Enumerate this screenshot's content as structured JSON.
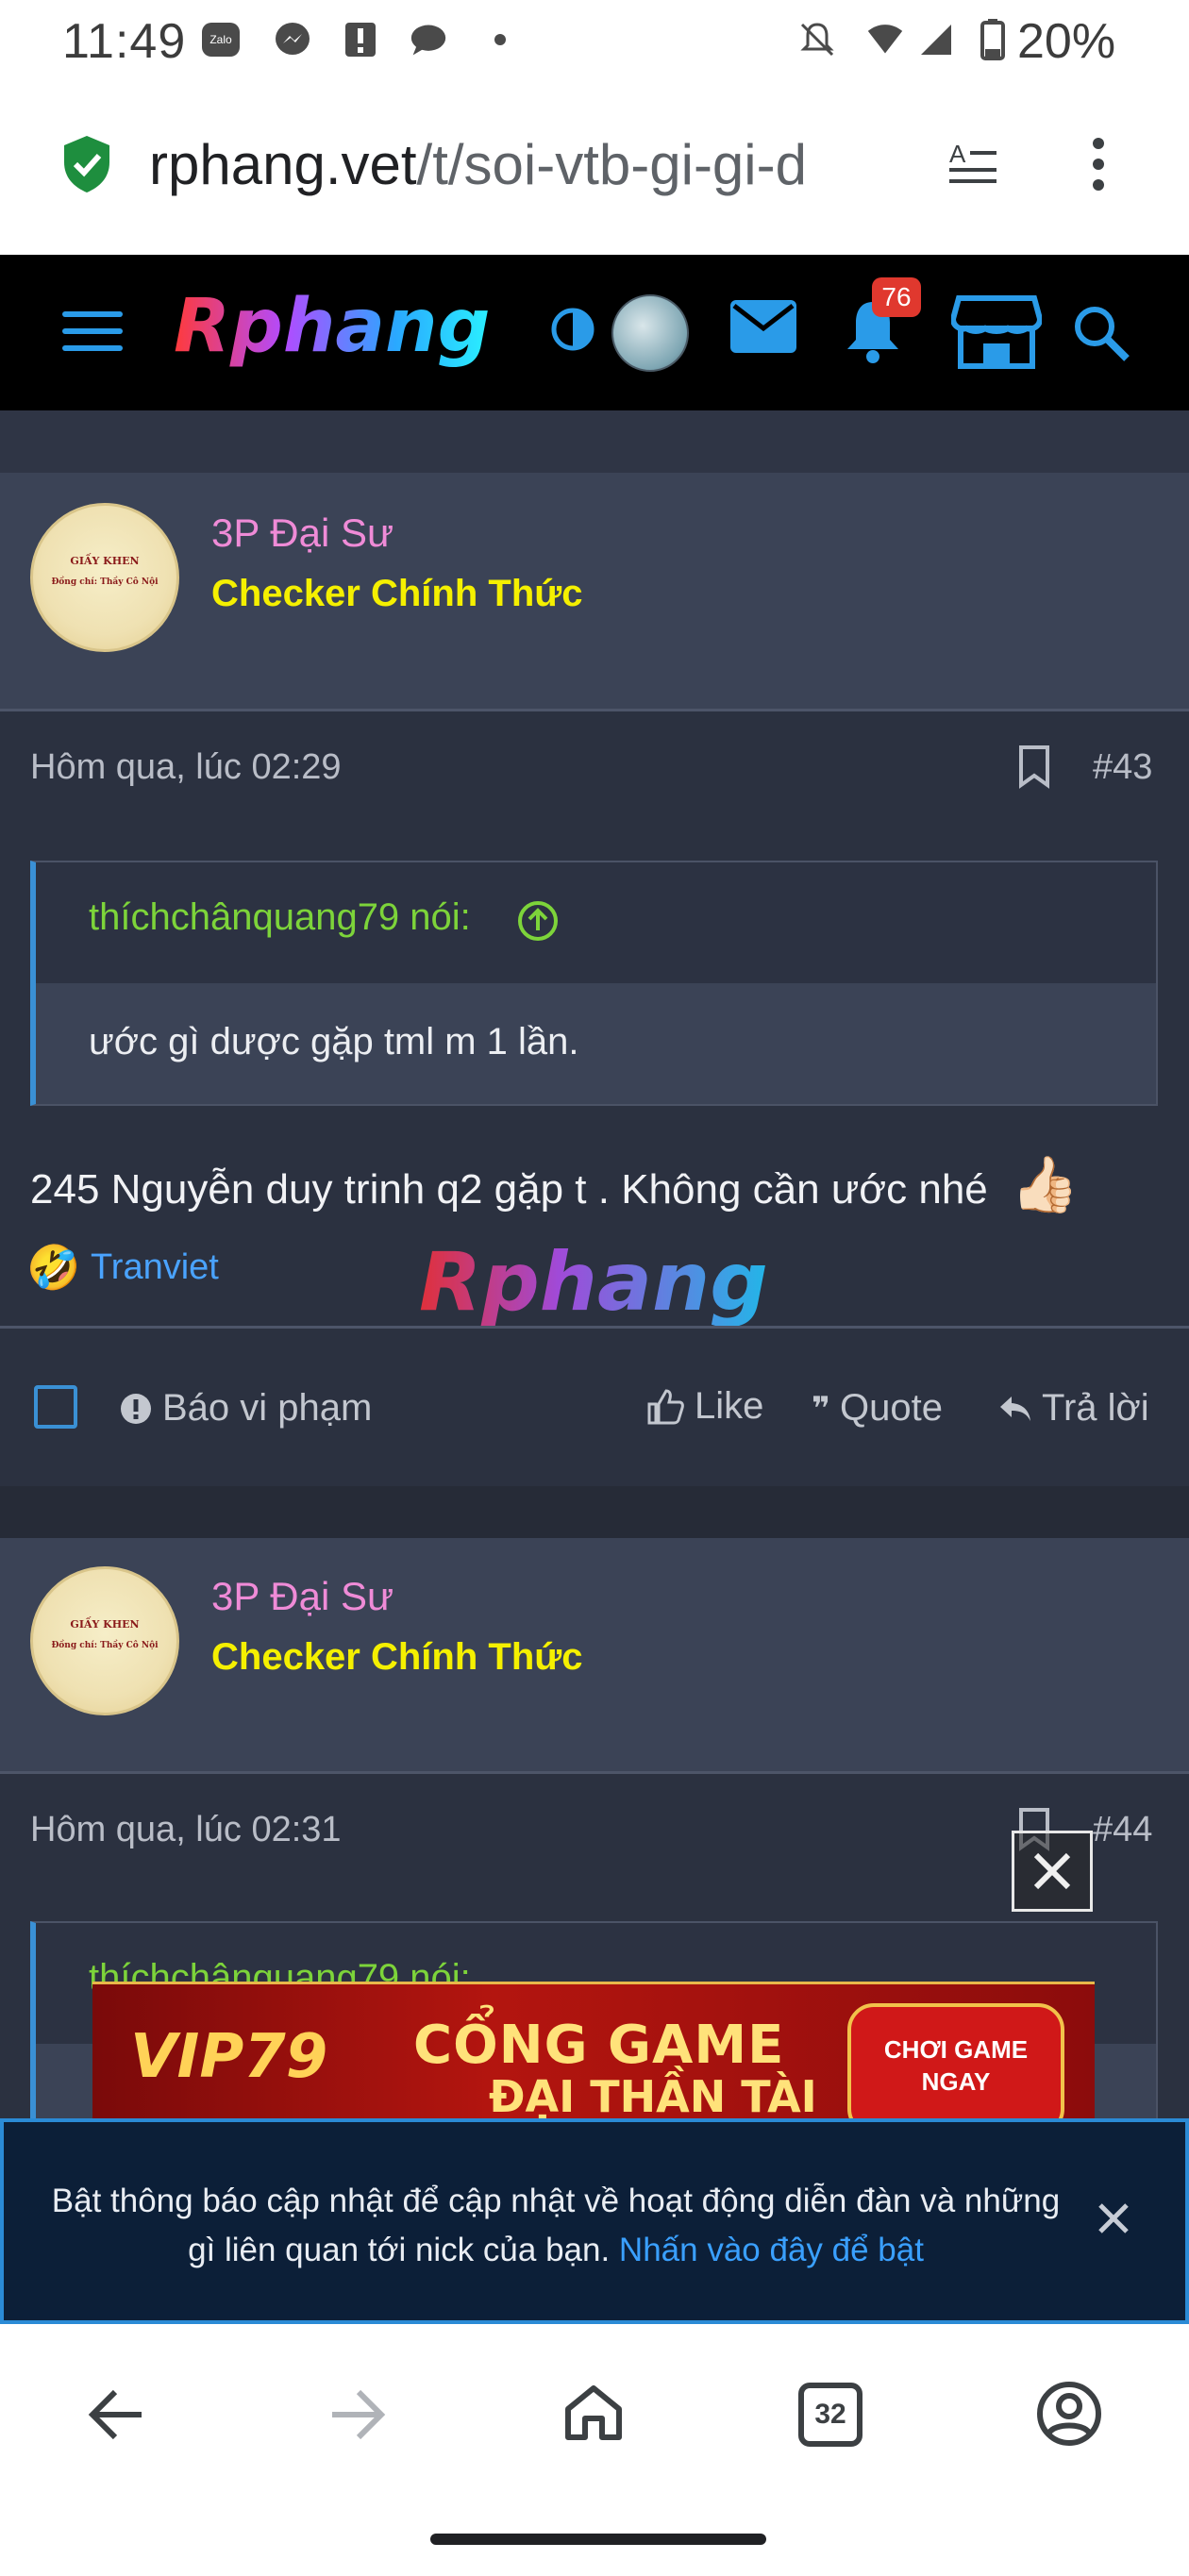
{
  "status_bar": {
    "time": "11:49",
    "battery": "20%",
    "icons": [
      "zalo-icon",
      "messenger-icon",
      "alert-icon",
      "chat-icon",
      "dot-icon",
      "mute-icon",
      "wifi-icon",
      "signal-icon",
      "battery-icon"
    ],
    "zalo_label": "Zalo"
  },
  "browser": {
    "url_main": "rphang.vet",
    "url_path": "/t/soi-vtb-gi-gi-d",
    "tab_count": "32"
  },
  "site_header": {
    "logo": "Rphang",
    "notification_count": "76"
  },
  "posts": [
    {
      "username": "3P Đại Sư",
      "user_title": "Checker Chính Thức",
      "avatar_text": [
        "GIẤY KHEN",
        "Đồng chí: Thầy Cô Nội"
      ],
      "timestamp": "Hôm qua, lúc 02:29",
      "post_number": "#43",
      "quote_author": "thíchchânquang79 nói:",
      "quote_text": "ước gì dược gặp tml m 1 lần.",
      "body": "245 Nguyễn duy trinh q2 gặp t . Không cần ước nhé",
      "body_emoji": "👍🏻",
      "reaction_emoji": "🤣",
      "reactor": "Tranviet"
    },
    {
      "username": "3P Đại Sư",
      "user_title": "Checker Chính Thức",
      "avatar_text": [
        "GIẤY KHEN",
        "Đồng chí: Thầy Cô Nội"
      ],
      "timestamp": "Hôm qua, lúc 02:31",
      "post_number": "#44",
      "quote_author": "thíchchânquang79 nói:"
    }
  ],
  "actions": {
    "report": "Báo vi phạm",
    "like": "Like",
    "quote": "Quote",
    "reply": "Trả lời"
  },
  "watermark": "Rphang",
  "ad": {
    "brand": "VIP79",
    "headline_1": "CỔNG GAME",
    "headline_2": "ĐẠI THẦN TÀI",
    "cta_1": "CHƠI GAME",
    "cta_2": "NGAY"
  },
  "notification_banner": {
    "text": "Bật thông báo cập nhật để cập nhật về hoạt động diễn đàn và những gì liên quan tới nick của bạn.",
    "link": "Nhấn vào đây để bật"
  },
  "colors": {
    "accent_blue": "#2b8bd6",
    "username_pink": "#ef8bd7",
    "title_yellow": "#f5f000",
    "quote_green": "#7dd43a",
    "post_bg": "#2b3140"
  }
}
